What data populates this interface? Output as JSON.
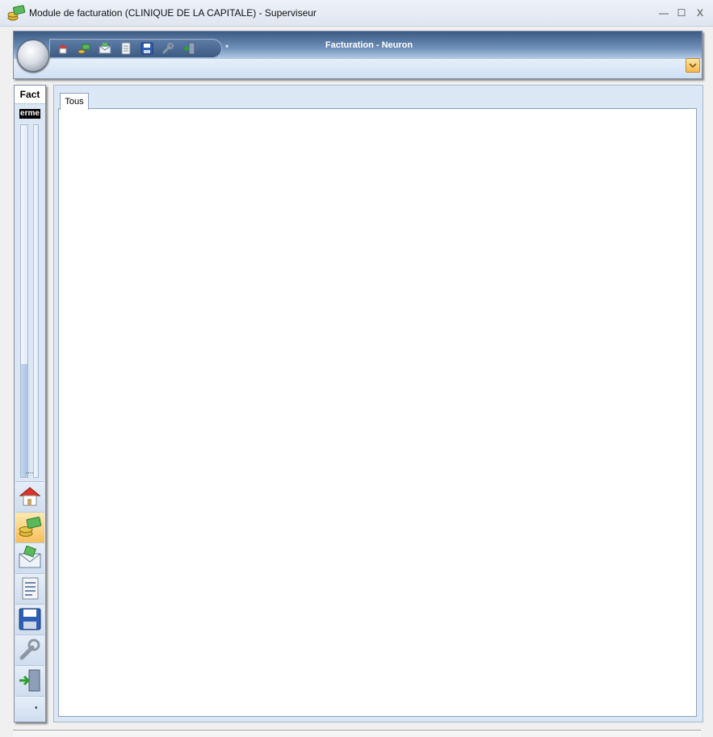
{
  "window": {
    "title": "Module de facturation (CLINIQUE DE LA CAPITALE) - Superviseur",
    "minimize_glyph": "—",
    "maximize_glyph": "☐",
    "close_glyph": "X"
  },
  "ribbon": {
    "title": "Facturation - Neuron",
    "quick_access_icons": [
      "home-icon",
      "billing-icon",
      "mail-icon",
      "document-icon",
      "save-icon",
      "wrench-icon",
      "exit-icon"
    ],
    "customize_glyph": "▾"
  },
  "nav": {
    "header_label": "Fact",
    "sub_label": "erme",
    "grip_glyph": "''''",
    "items": [
      {
        "icon": "home-icon",
        "active": false
      },
      {
        "icon": "billing-icon",
        "active": true
      },
      {
        "icon": "mail-icon",
        "active": false
      },
      {
        "icon": "document-icon",
        "active": false
      },
      {
        "icon": "save-icon",
        "active": false
      },
      {
        "icon": "wrench-icon",
        "active": false
      },
      {
        "icon": "exit-icon",
        "active": false
      }
    ],
    "more_glyph": "▾"
  },
  "main": {
    "tabs": [
      {
        "label": "Tous",
        "active": true
      }
    ]
  },
  "colors": {
    "ribbon_dark": "#3b5b84",
    "ribbon_light": "#b4cbe6",
    "panel_bg": "#dbe7f5",
    "active_item": "#f6bf5a"
  }
}
